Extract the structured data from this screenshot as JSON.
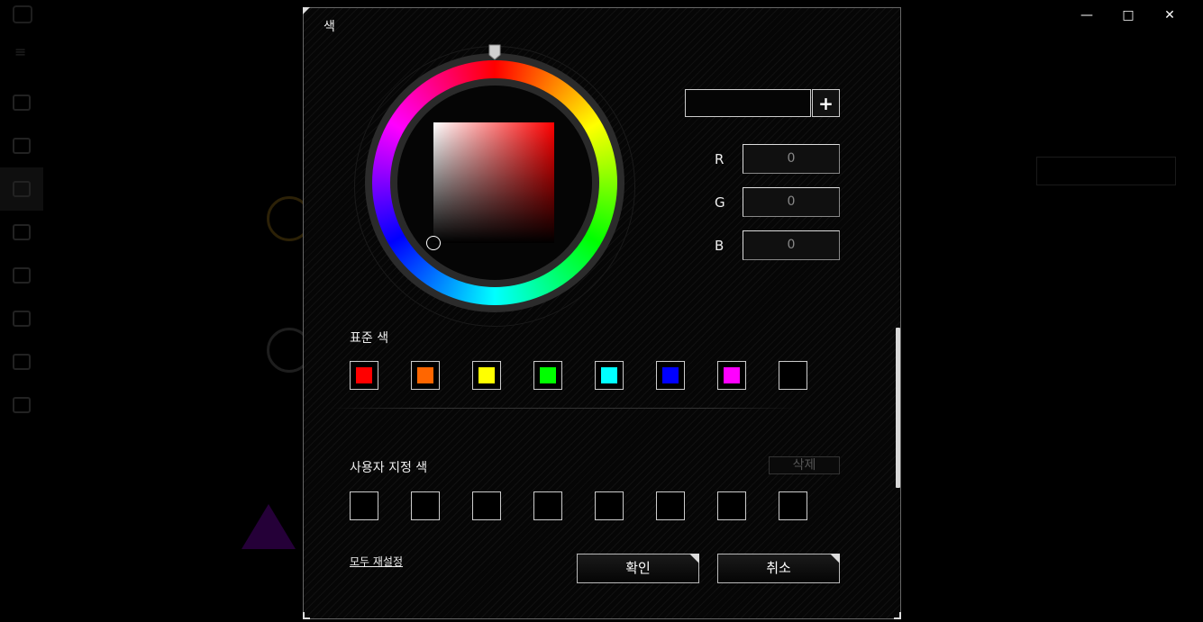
{
  "window": {
    "minimize_icon": "minimize-icon",
    "maximize_icon": "maximize-icon",
    "close_icon": "close-icon"
  },
  "dialog": {
    "title": "색",
    "hex_value": "",
    "add_label": "+",
    "rgb": [
      {
        "label": "R",
        "value": "0"
      },
      {
        "label": "G",
        "value": "0"
      },
      {
        "label": "B",
        "value": "0"
      }
    ],
    "standard_colors_label": "표준 색",
    "standard_colors": [
      "#ff0000",
      "#ff6600",
      "#ffff00",
      "#00ff00",
      "#00ffff",
      "#0000ff",
      "#ff00ff",
      "#000000"
    ],
    "custom_colors_label": "사용자 지정 색",
    "custom_colors_count": 8,
    "delete_label": "삭제",
    "reset_all_label": "모두 재설정",
    "ok_label": "확인",
    "cancel_label": "취소"
  }
}
